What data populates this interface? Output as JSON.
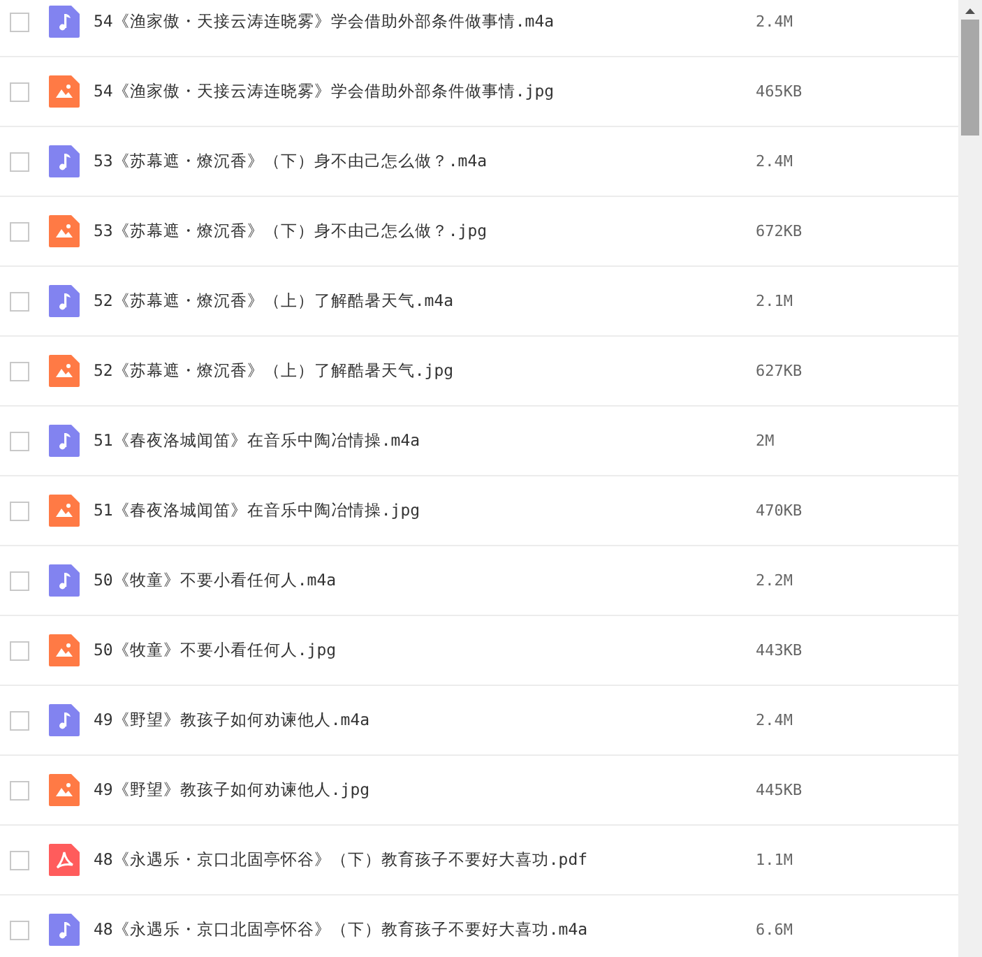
{
  "files": [
    {
      "kind": "audio",
      "checked": false,
      "name": "54《渔家傲・天接云涛连晓雾》学会借助外部条件做事情.m4a",
      "size": "2.4M"
    },
    {
      "kind": "image",
      "checked": false,
      "name": "54《渔家傲・天接云涛连晓雾》学会借助外部条件做事情.jpg",
      "size": "465KB"
    },
    {
      "kind": "audio",
      "checked": false,
      "name": "53《苏幕遮・燎沉香》（下）身不由己怎么做？.m4a",
      "size": "2.4M"
    },
    {
      "kind": "image",
      "checked": false,
      "name": "53《苏幕遮・燎沉香》（下）身不由己怎么做？.jpg",
      "size": "672KB"
    },
    {
      "kind": "audio",
      "checked": false,
      "name": "52《苏幕遮・燎沉香》（上）了解酷暑天气.m4a",
      "size": "2.1M"
    },
    {
      "kind": "image",
      "checked": false,
      "name": "52《苏幕遮・燎沉香》（上）了解酷暑天气.jpg",
      "size": "627KB"
    },
    {
      "kind": "audio",
      "checked": false,
      "name": "51《春夜洛城闻笛》在音乐中陶冶情操.m4a",
      "size": "2M"
    },
    {
      "kind": "image",
      "checked": false,
      "name": "51《春夜洛城闻笛》在音乐中陶冶情操.jpg",
      "size": "470KB"
    },
    {
      "kind": "audio",
      "checked": false,
      "name": "50《牧童》不要小看任何人.m4a",
      "size": "2.2M"
    },
    {
      "kind": "image",
      "checked": false,
      "name": "50《牧童》不要小看任何人.jpg",
      "size": "443KB"
    },
    {
      "kind": "audio",
      "checked": false,
      "name": "49《野望》教孩子如何劝谏他人.m4a",
      "size": "2.4M"
    },
    {
      "kind": "image",
      "checked": false,
      "name": "49《野望》教孩子如何劝谏他人.jpg",
      "size": "445KB"
    },
    {
      "kind": "pdf",
      "checked": false,
      "name": "48《永遇乐・京口北固亭怀谷》（下）教育孩子不要好大喜功.pdf",
      "size": "1.1M"
    },
    {
      "kind": "audio",
      "checked": false,
      "name": "48《永遇乐・京口北固亭怀谷》（下）教育孩子不要好大喜功.m4a",
      "size": "6.6M"
    }
  ]
}
